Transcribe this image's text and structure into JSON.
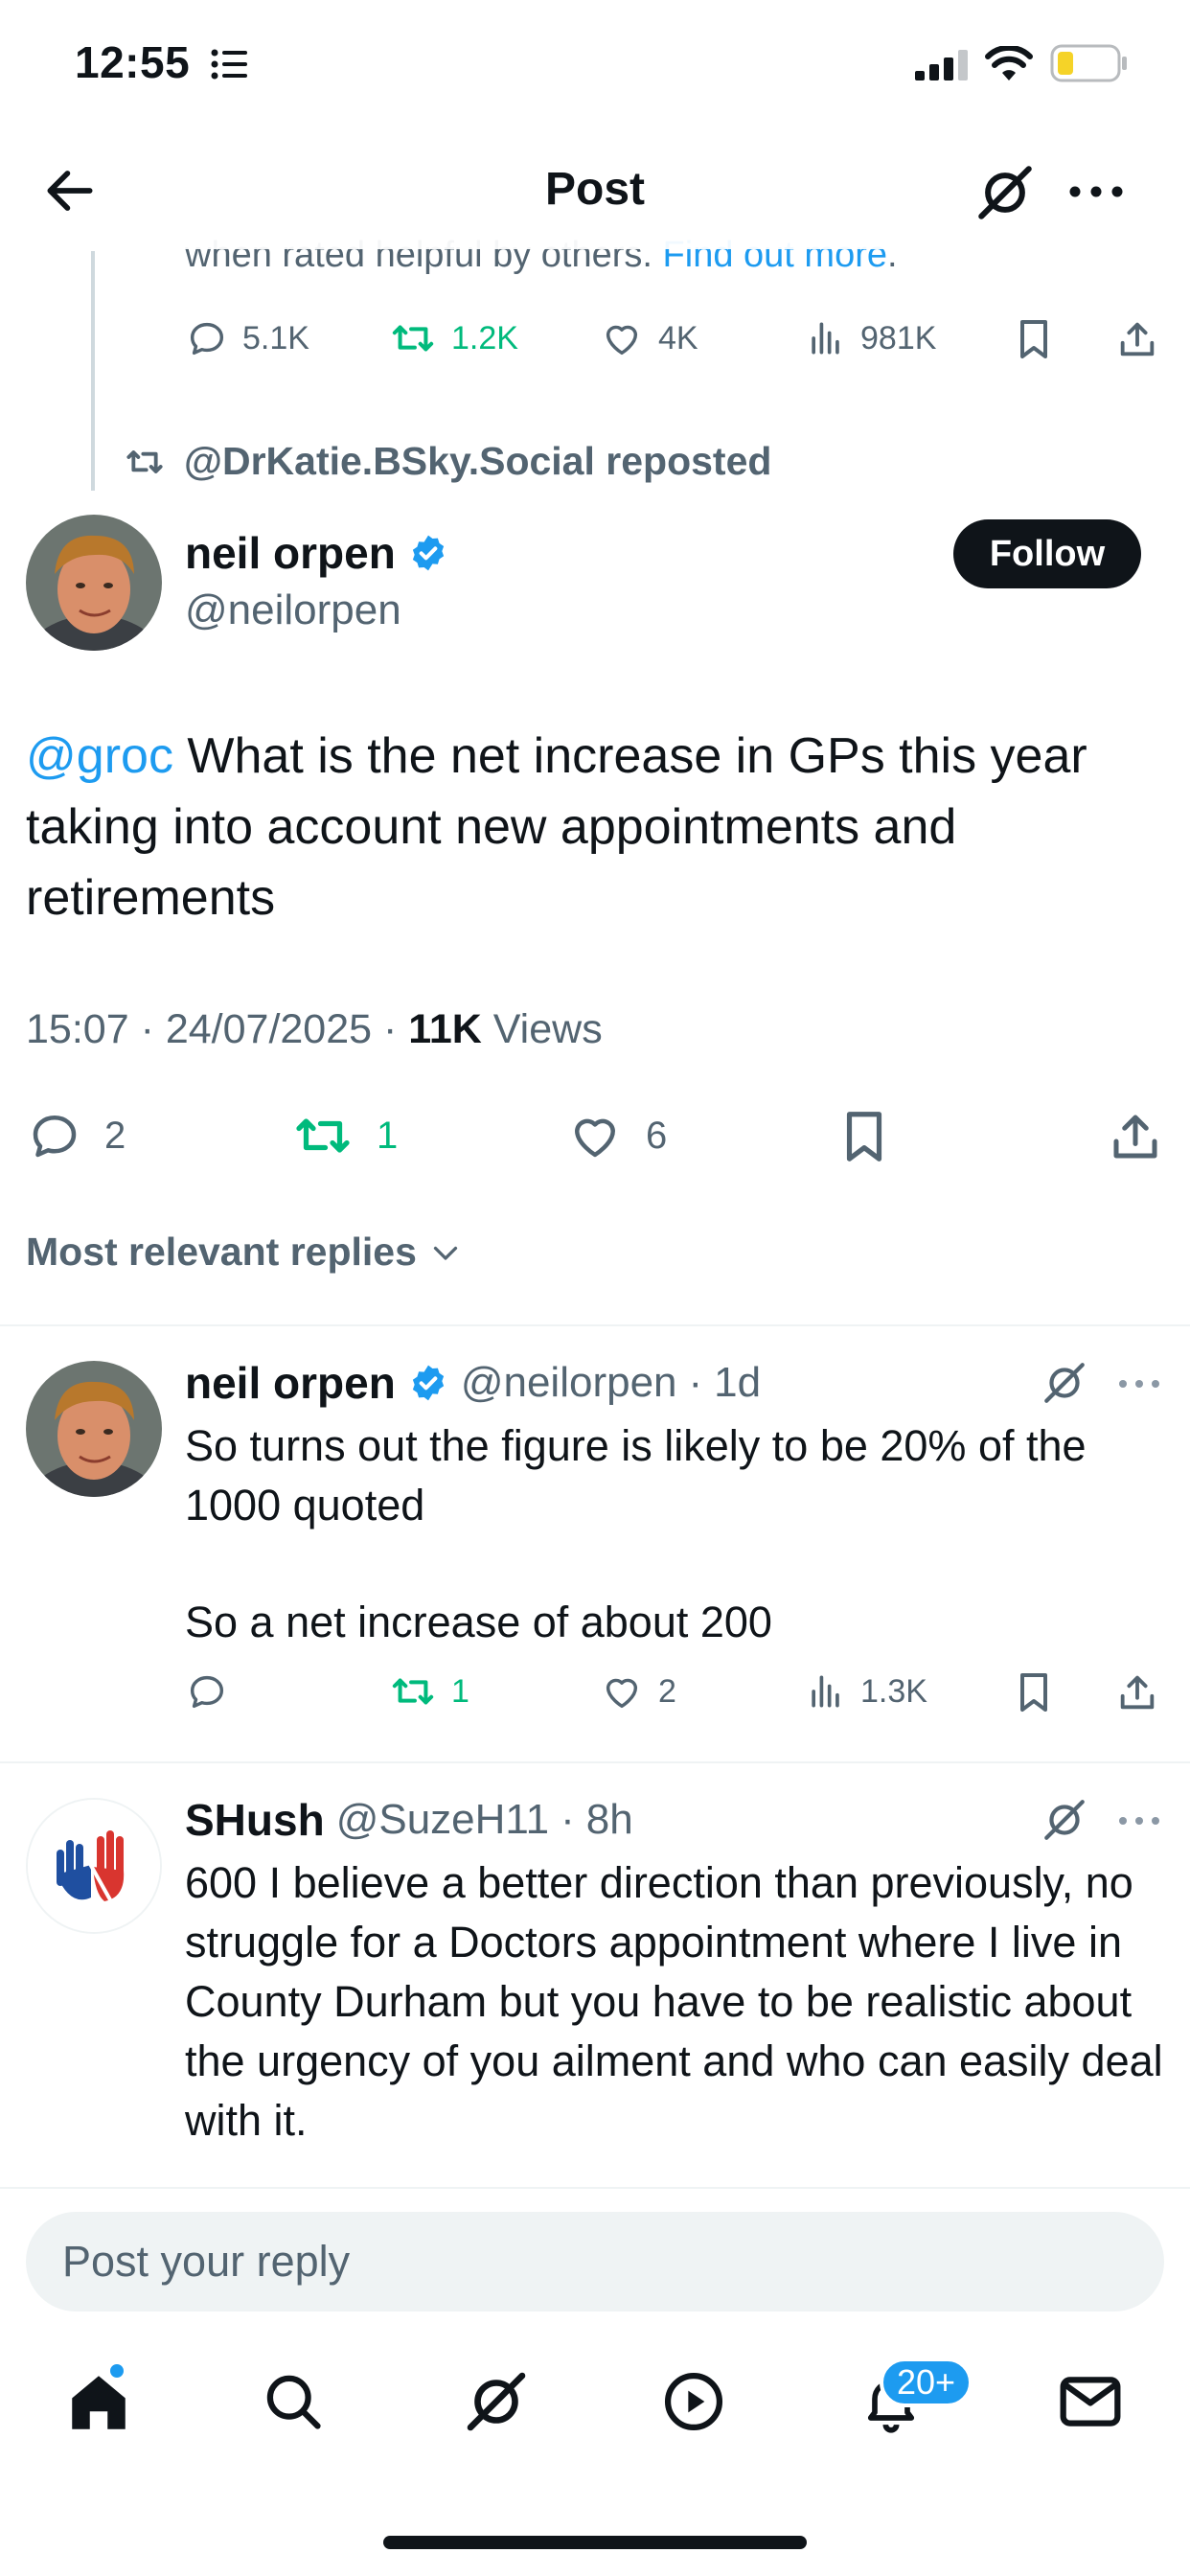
{
  "status_bar": {
    "time": "12:55"
  },
  "header": {
    "title": "Post"
  },
  "prior_post": {
    "note_text": "when rated helpful by others.",
    "note_link": "Find out more",
    "note_tail": ".",
    "stats": {
      "replies": "5.1K",
      "reposts": "1.2K",
      "likes": "4K",
      "views": "981K"
    }
  },
  "repost_line": {
    "text": "@DrKatie.BSky.Social reposted"
  },
  "main_post": {
    "author_name": "neil orpen",
    "author_handle": "@neilorpen",
    "follow_label": "Follow",
    "mention": "@groc",
    "text": " What is the net increase in GPs this year taking into account new appointments and retirements",
    "time": "15:07",
    "date": "24/07/2025",
    "views_count": "11K",
    "views_label": "Views",
    "sep": "·",
    "stats": {
      "replies": "2",
      "reposts": "1",
      "likes": "6"
    }
  },
  "sort_label": "Most relevant replies",
  "replies": [
    {
      "name": "neil orpen",
      "handle": "@neilorpen",
      "time": "1d",
      "sep": "·",
      "text_1": "So turns out the figure is likely to be 20% of the 1000 quoted",
      "text_2": "So a net increase of about 200",
      "stats": {
        "replies": "",
        "reposts": "1",
        "likes": "2",
        "views": "1.3K"
      }
    },
    {
      "name": "SHush",
      "handle": "@SuzeH11",
      "time": "8h",
      "sep": "·",
      "text_1": "600 I believe  a better direction than previously, no struggle for a Doctors appointment where I live in County Durham but you have to be realistic about the urgency of you ailment and who can easily deal with it."
    }
  ],
  "reply_box": {
    "placeholder": "Post your reply"
  },
  "tabbar": {
    "notifications_badge": "20+"
  },
  "colors": {
    "accent": "#1d9bf0",
    "repost_green": "#00ba7c",
    "text": "#0f1419",
    "muted": "#536471"
  }
}
